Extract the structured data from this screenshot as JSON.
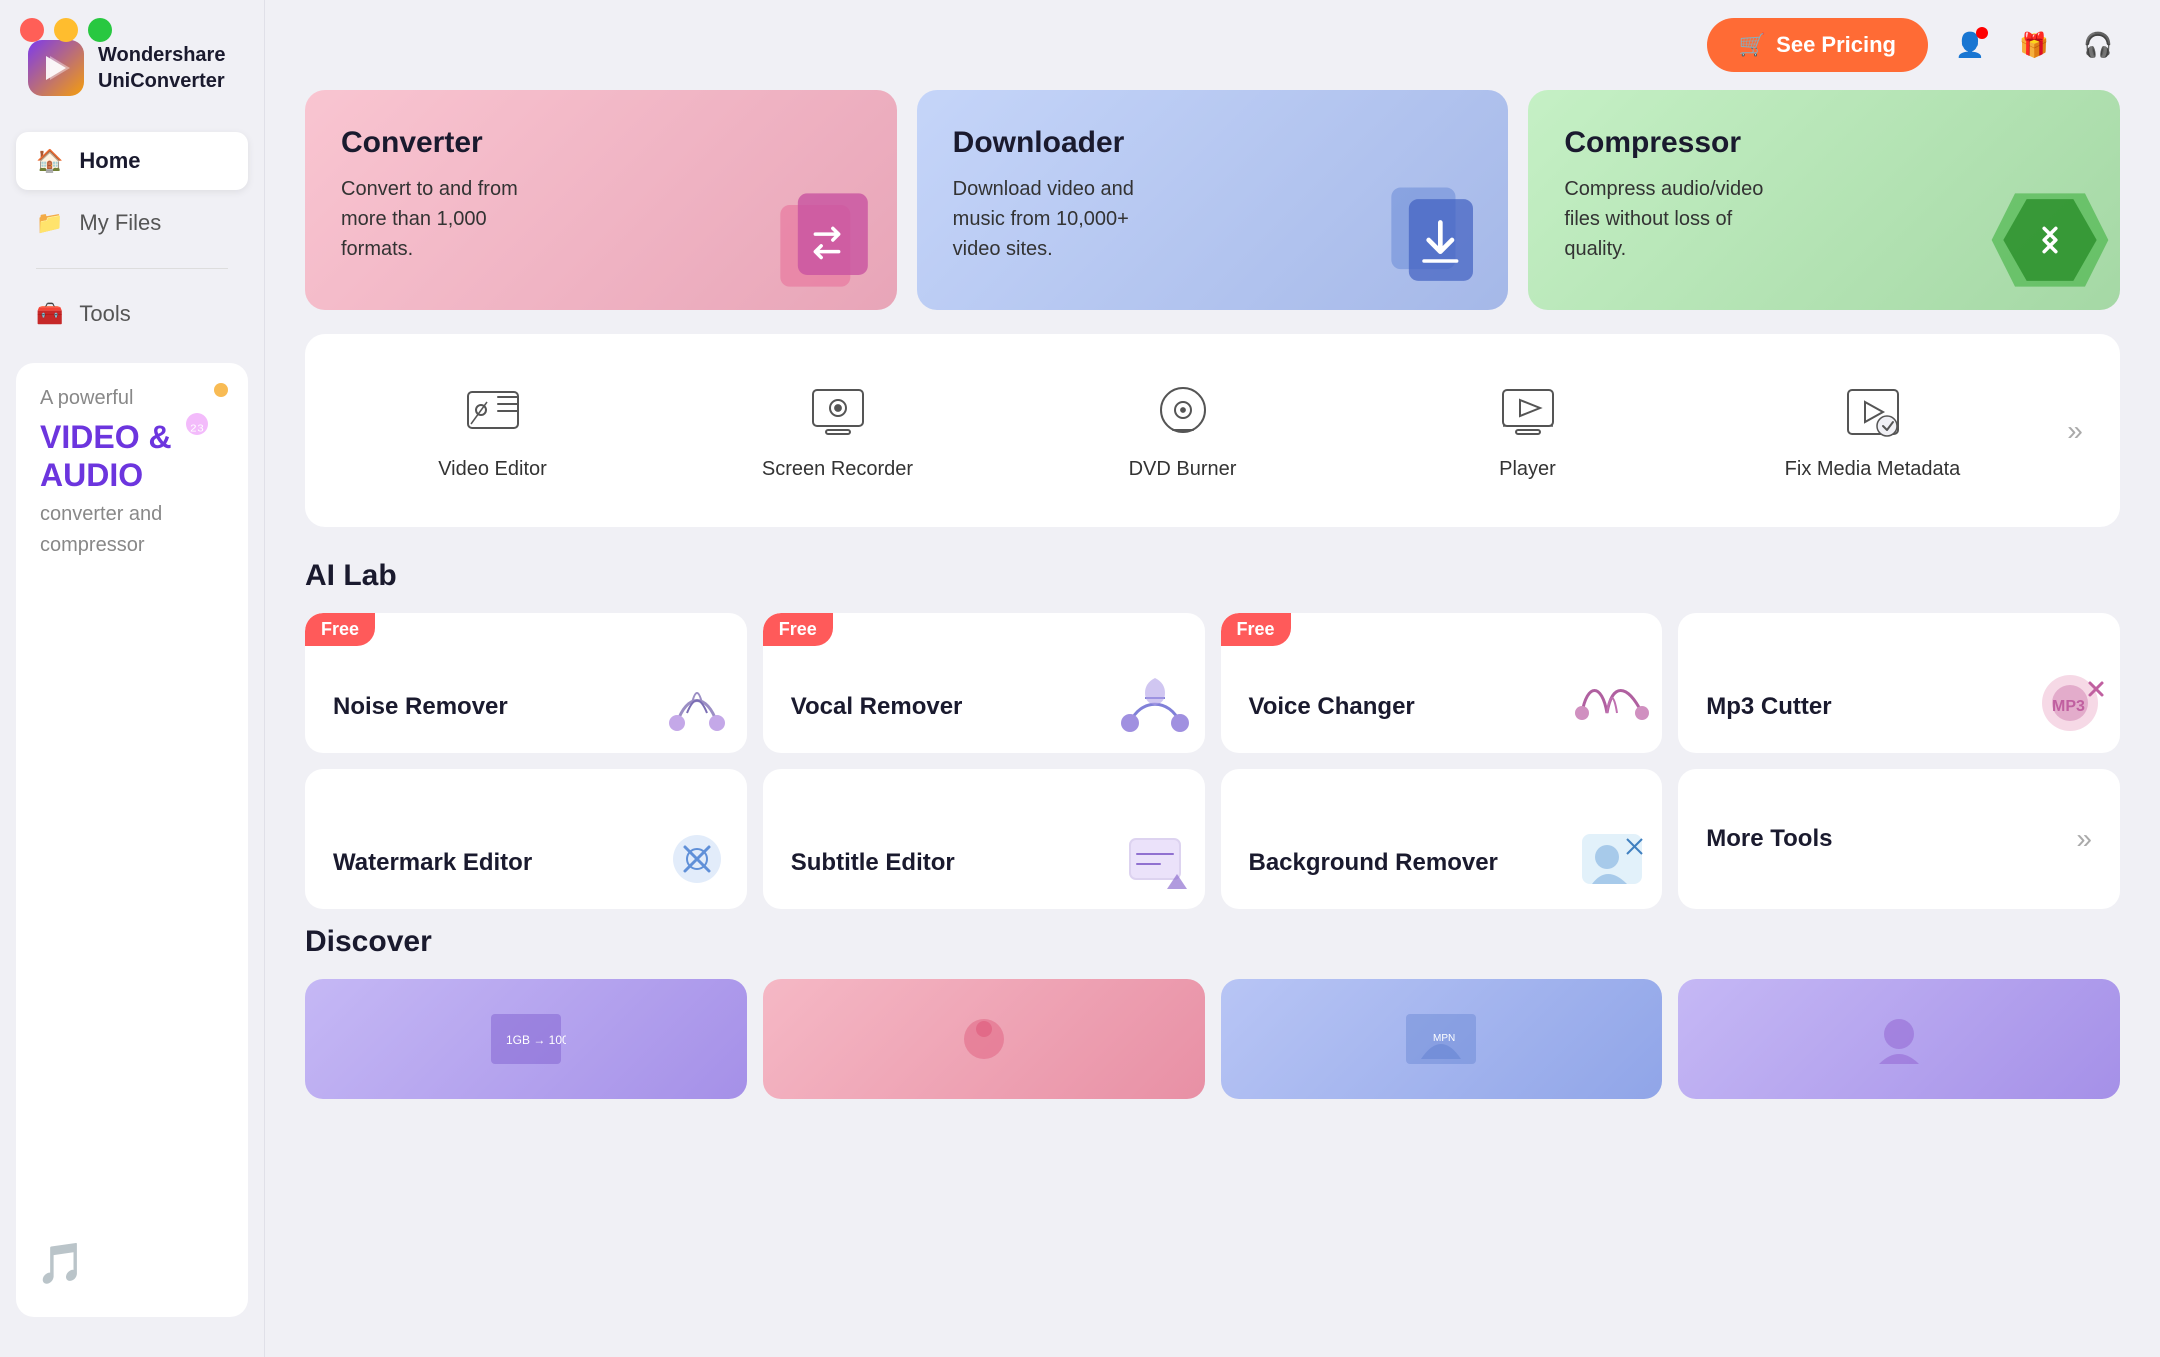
{
  "window": {
    "title": "Wondershare UniConverter"
  },
  "sidebar": {
    "logo": {
      "name": "Wondershare UniConverter",
      "line1": "Wondershare",
      "line2": "UniConverter"
    },
    "nav": [
      {
        "id": "home",
        "label": "Home",
        "icon": "🏠",
        "active": true
      },
      {
        "id": "myfiles",
        "label": "My Files",
        "icon": "📁",
        "active": false
      },
      {
        "id": "tools",
        "label": "Tools",
        "icon": "🧰",
        "active": false
      }
    ],
    "banner": {
      "line1": "A powerful",
      "line2": "VIDEO &",
      "line3": "AUDIO",
      "line4": "converter and",
      "line5": "compressor"
    }
  },
  "topbar": {
    "pricing_button": "See Pricing",
    "icons": [
      "user",
      "gift",
      "headset"
    ]
  },
  "hero_cards": [
    {
      "id": "converter",
      "title": "Converter",
      "description": "Convert to and from more than 1,000 formats.",
      "color": "converter"
    },
    {
      "id": "downloader",
      "title": "Downloader",
      "description": "Download video and music from 10,000+ video sites.",
      "color": "downloader"
    },
    {
      "id": "compressor",
      "title": "Compressor",
      "description": "Compress audio/video files without loss of quality.",
      "color": "compressor"
    }
  ],
  "tools_row": {
    "items": [
      {
        "id": "video-editor",
        "label": "Video Editor"
      },
      {
        "id": "screen-recorder",
        "label": "Screen Recorder"
      },
      {
        "id": "dvd-burner",
        "label": "DVD Burner"
      },
      {
        "id": "player",
        "label": "Player"
      },
      {
        "id": "fix-media-metadata",
        "label": "Fix Media Metadata"
      }
    ],
    "arrow_label": "»"
  },
  "ai_lab": {
    "section_title": "AI Lab",
    "cards_row1": [
      {
        "id": "noise-remover",
        "title": "Noise Remover",
        "free": true
      },
      {
        "id": "vocal-remover",
        "title": "Vocal Remover",
        "free": true
      },
      {
        "id": "voice-changer",
        "title": "Voice Changer",
        "free": true
      },
      {
        "id": "mp3-cutter",
        "title": "Mp3 Cutter",
        "free": false
      }
    ],
    "cards_row2": [
      {
        "id": "watermark-editor",
        "title": "Watermark Editor",
        "free": false
      },
      {
        "id": "subtitle-editor",
        "title": "Subtitle Editor",
        "free": false
      },
      {
        "id": "background-remover",
        "title": "Background Remover",
        "free": false
      }
    ],
    "more_tools": {
      "title": "More Tools",
      "arrow": "»"
    },
    "free_label": "Free"
  },
  "discover": {
    "section_title": "Discover",
    "cards": [
      {
        "id": "disc-1",
        "theme": "purple"
      },
      {
        "id": "disc-2",
        "theme": "pink"
      },
      {
        "id": "disc-3",
        "theme": "blue"
      },
      {
        "id": "disc-4",
        "theme": "purple"
      }
    ]
  }
}
